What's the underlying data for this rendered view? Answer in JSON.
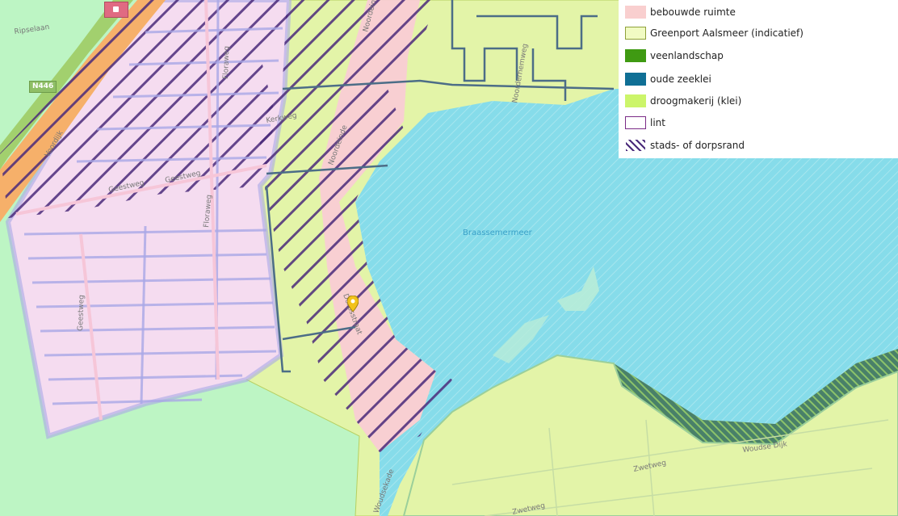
{
  "map": {
    "streets": [
      "Ripselaan",
      "Geestweg",
      "Geestweg",
      "Geestweg",
      "Floraweg",
      "Floraweg",
      "Kerkweg",
      "Noordeinde",
      "Dorpsstraat",
      "Voordijk",
      "Noordeinde",
      "Noorderhemweg",
      "Woudsekade",
      "Zwetweg",
      "Zwetweg",
      "Woudse Dijk"
    ],
    "water_label": "Braassemermeer",
    "road_badge": "N446",
    "poi_icon": "parking-icon",
    "pin_icon": "location-pin-icon"
  },
  "legend": {
    "items": [
      {
        "label": "bebouwde ruimte",
        "swatch": "fill",
        "color": "#f9cfcf",
        "border": "#f9cfcf"
      },
      {
        "label": "Greenport Aalsmeer (indicatief)",
        "swatch": "outline",
        "color": "#f1fbc3",
        "border": "#8ea03a"
      },
      {
        "label": "veenlandschap",
        "swatch": "fill",
        "color": "#3f9a12",
        "border": "#3f9a12"
      },
      {
        "label": "oude zeeklei",
        "swatch": "fill",
        "color": "#0f6f95",
        "border": "#0f6f95"
      },
      {
        "label": "droogmakerij (klei)",
        "swatch": "fill",
        "color": "#ccf56a",
        "border": "#ccf56a"
      },
      {
        "label": "lint",
        "swatch": "outline",
        "color": "#ffffff",
        "border": "#7b2b86"
      },
      {
        "label": "stads- of dorpsrand",
        "swatch": "hatch",
        "color": "#4a2a7a",
        "border": "#ffffff"
      }
    ]
  },
  "colors": {
    "water": "#86dcea",
    "meadow": "#bdf5c4",
    "greenport": "#e3f4a8",
    "built": "#f5dcf0",
    "hatch": "#4a2a7a"
  }
}
